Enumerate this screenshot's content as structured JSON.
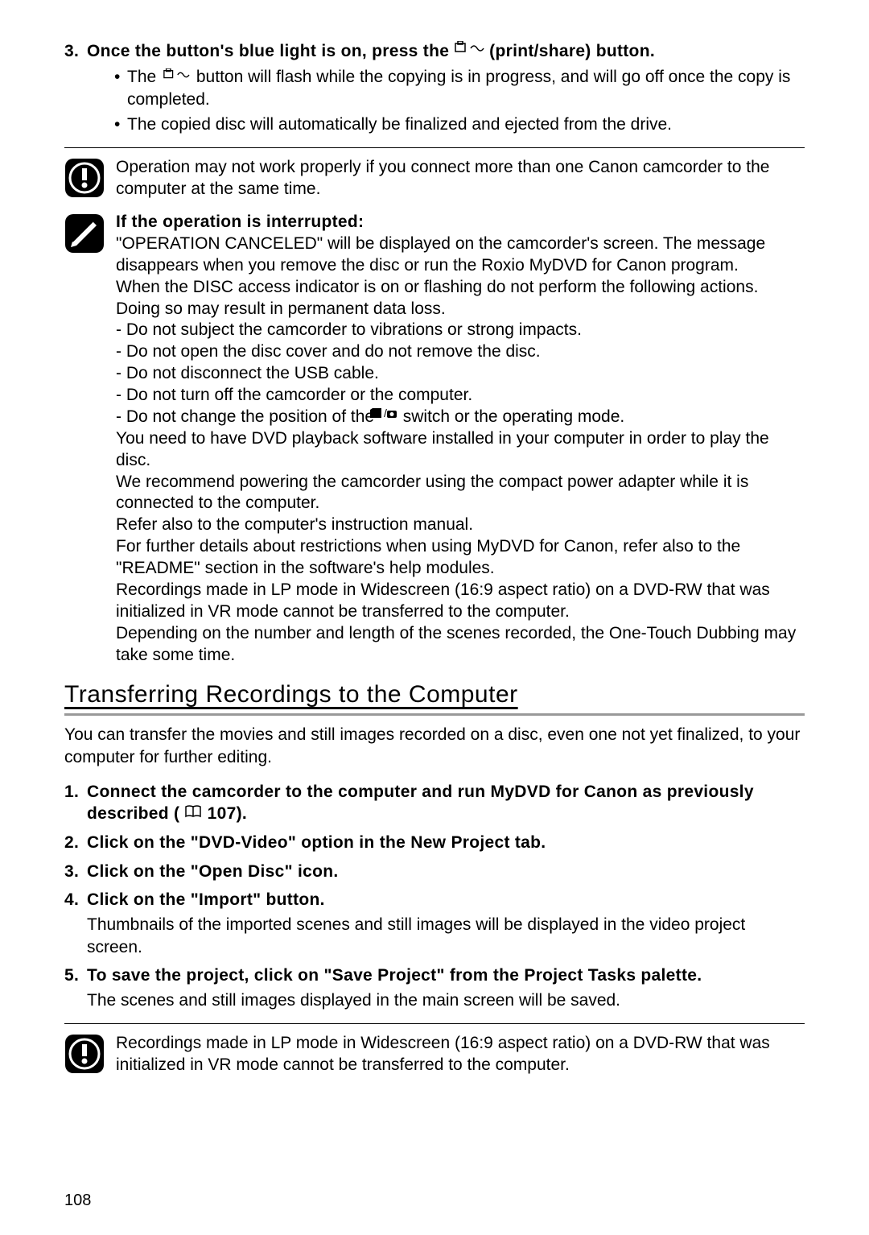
{
  "step3": {
    "num": "3.",
    "text_before_icon": "Once the button's blue light is on, press the ",
    "text_after_icon": " (print/share) button.",
    "bullet1_before": "The ",
    "bullet1_after": " button will flash while the copying is in progress, and will go off once the copy is completed.",
    "bullet2": "The copied disc will automatically be finalized and ejected from the drive."
  },
  "warn1": "Operation may not work properly if you connect more than one Canon camcorder to the computer at the same time.",
  "notes": {
    "heading": "If the operation is interrupted:",
    "p1": "\"OPERATION CANCELED\" will be displayed on the camcorder's screen. The message disappears when you remove the disc or run the Roxio MyDVD for Canon program.",
    "p2": "When the DISC access indicator is on or flashing do not perform the following actions. Doing so may result in permanent data loss.",
    "d1": "- Do not subject the camcorder to vibrations or strong impacts.",
    "d2": "- Do not open the disc cover and do not remove the disc.",
    "d3": "- Do not disconnect the USB cable.",
    "d4": "- Do not turn off the camcorder or the computer.",
    "d5_before": "- Do not change the position of the ",
    "d5_after": " switch or the operating mode.",
    "p3": "You need to have DVD playback software installed in your computer in order to play the disc.",
    "p4": "We recommend powering the camcorder using the compact power adapter while it is connected to the computer.",
    "p5": "Refer also to the computer's instruction manual.",
    "p6": "For further details about restrictions when using MyDVD for Canon, refer also to the \"README\" section in the software's help modules.",
    "p7": "Recordings made in LP mode in Widescreen (16:9 aspect ratio) on a DVD-RW that was initialized in VR mode cannot be transferred to the computer.",
    "p8": "Depending on the number and length of the scenes recorded, the One-Touch Dubbing may take some time."
  },
  "heading": "Transferring Recordings to the Computer",
  "intro": "You can transfer the movies and still images recorded on a disc, even one not yet finalized, to your computer for further editing.",
  "t1": {
    "num": "1.",
    "text_before": "Connect the camcorder to the computer and run MyDVD for Canon as previously described (",
    "text_after": " 107)."
  },
  "t2": {
    "num": "2.",
    "text": "Click on the \"DVD-Video\" option in the New Project tab."
  },
  "t3": {
    "num": "3.",
    "text": "Click on the \"Open Disc\" icon."
  },
  "t4": {
    "num": "4.",
    "text": "Click on the \"Import\" button.",
    "desc": "Thumbnails of the imported scenes and still images will be displayed in the video project screen."
  },
  "t5": {
    "num": "5.",
    "text": "To save the project, click on \"Save Project\" from the Project Tasks palette.",
    "desc": "The scenes and still images displayed in the main screen will be saved."
  },
  "warn2": "Recordings made in LP mode in Widescreen (16:9 aspect ratio) on a DVD-RW that was initialized in VR mode cannot be transferred to the computer.",
  "page": "108",
  "icons": {
    "print_share": "print-share-icon",
    "mode_switch": "mode-switch-icon",
    "book": "book-ref-icon",
    "warning": "warning-icon",
    "notes": "notes-icon"
  }
}
